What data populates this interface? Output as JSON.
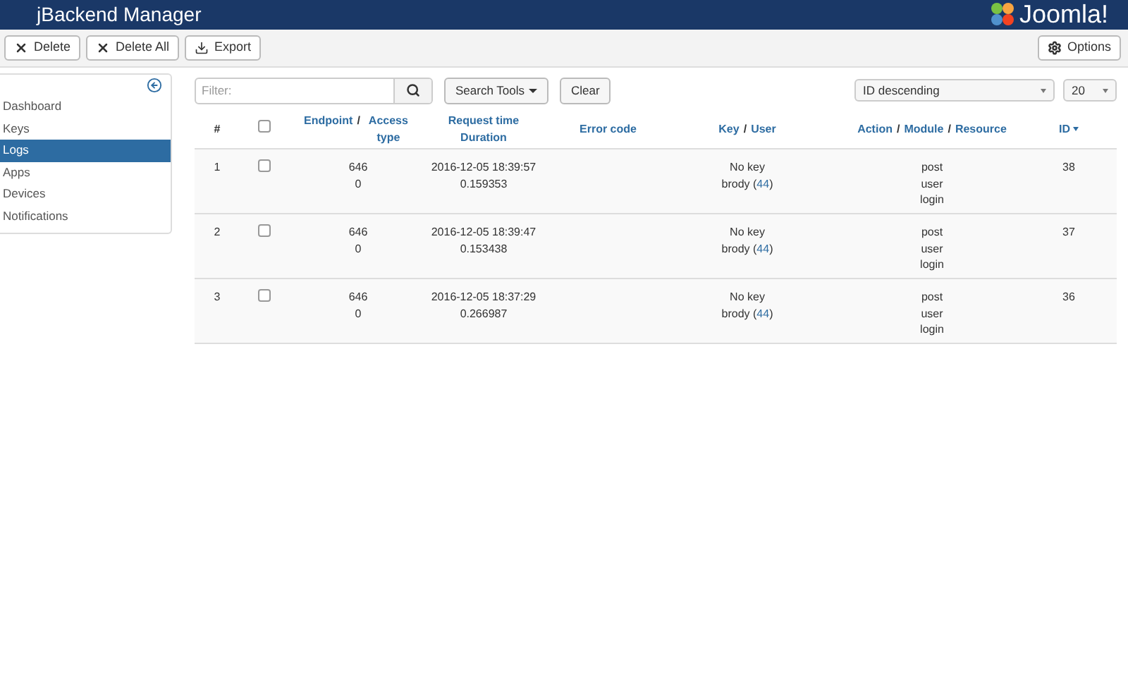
{
  "header": {
    "title": "jBackend Manager",
    "logo_text": "Joomla!"
  },
  "toolbar": {
    "buttons": [
      {
        "label": "Delete",
        "kind": "delete"
      },
      {
        "label": "Delete All",
        "kind": "delete"
      },
      {
        "label": "Export",
        "kind": "export"
      }
    ],
    "options": "Options"
  },
  "sidebar": {
    "items": [
      {
        "label": "Dashboard",
        "selected": false
      },
      {
        "label": "Keys",
        "selected": false
      },
      {
        "label": "Logs",
        "selected": true
      },
      {
        "label": "Apps",
        "selected": false
      },
      {
        "label": "Devices",
        "selected": false
      },
      {
        "label": "Notifications",
        "selected": false
      }
    ]
  },
  "filters": {
    "placeholder": "Filter:",
    "search_tools": "Search Tools",
    "clear": "Clear",
    "ordering": "ID descending",
    "limit": "20"
  },
  "table": {
    "columns": [
      {
        "kind": "plain",
        "parts": [
          "#"
        ]
      },
      {
        "kind": "check",
        "checked": false
      },
      {
        "kind": "links",
        "parts": [
          "Endpoint",
          "Access type"
        ],
        "separator": "/"
      },
      {
        "kind": "stack",
        "parts": [
          "Request time",
          "Duration"
        ]
      },
      {
        "kind": "links",
        "parts": [
          "Error code"
        ]
      },
      {
        "kind": "links",
        "parts": [
          "Key",
          "User"
        ],
        "separator": "/"
      },
      {
        "kind": "links",
        "parts": [
          "Action",
          "Module",
          "Resource"
        ],
        "separator": "/"
      },
      {
        "kind": "sort",
        "parts": [
          "ID"
        ]
      }
    ],
    "rows": [
      {
        "num": "1",
        "checked": false,
        "endpoint": "646",
        "access": "0",
        "time": "2016-12-05 18:39:57",
        "duration": "0.159353",
        "key": "No key",
        "user": "brody (",
        "user_id": "44",
        "user_suffix": ")",
        "action": "post",
        "module": "user",
        "resource": "login",
        "id": "38"
      },
      {
        "num": "2",
        "checked": false,
        "endpoint": "646",
        "access": "0",
        "time": "2016-12-05 18:39:47",
        "duration": "0.153438",
        "key": "No key",
        "user": "brody (",
        "user_id": "44",
        "user_suffix": ")",
        "action": "post",
        "module": "user",
        "resource": "login",
        "id": "37"
      },
      {
        "num": "3",
        "checked": false,
        "endpoint": "646",
        "access": "0",
        "time": "2016-12-05 18:37:29",
        "duration": "0.266987",
        "key": "No key",
        "user": "brody (",
        "user_id": "44",
        "user_suffix": ")",
        "action": "post",
        "module": "user",
        "resource": "login",
        "id": "36"
      }
    ]
  }
}
